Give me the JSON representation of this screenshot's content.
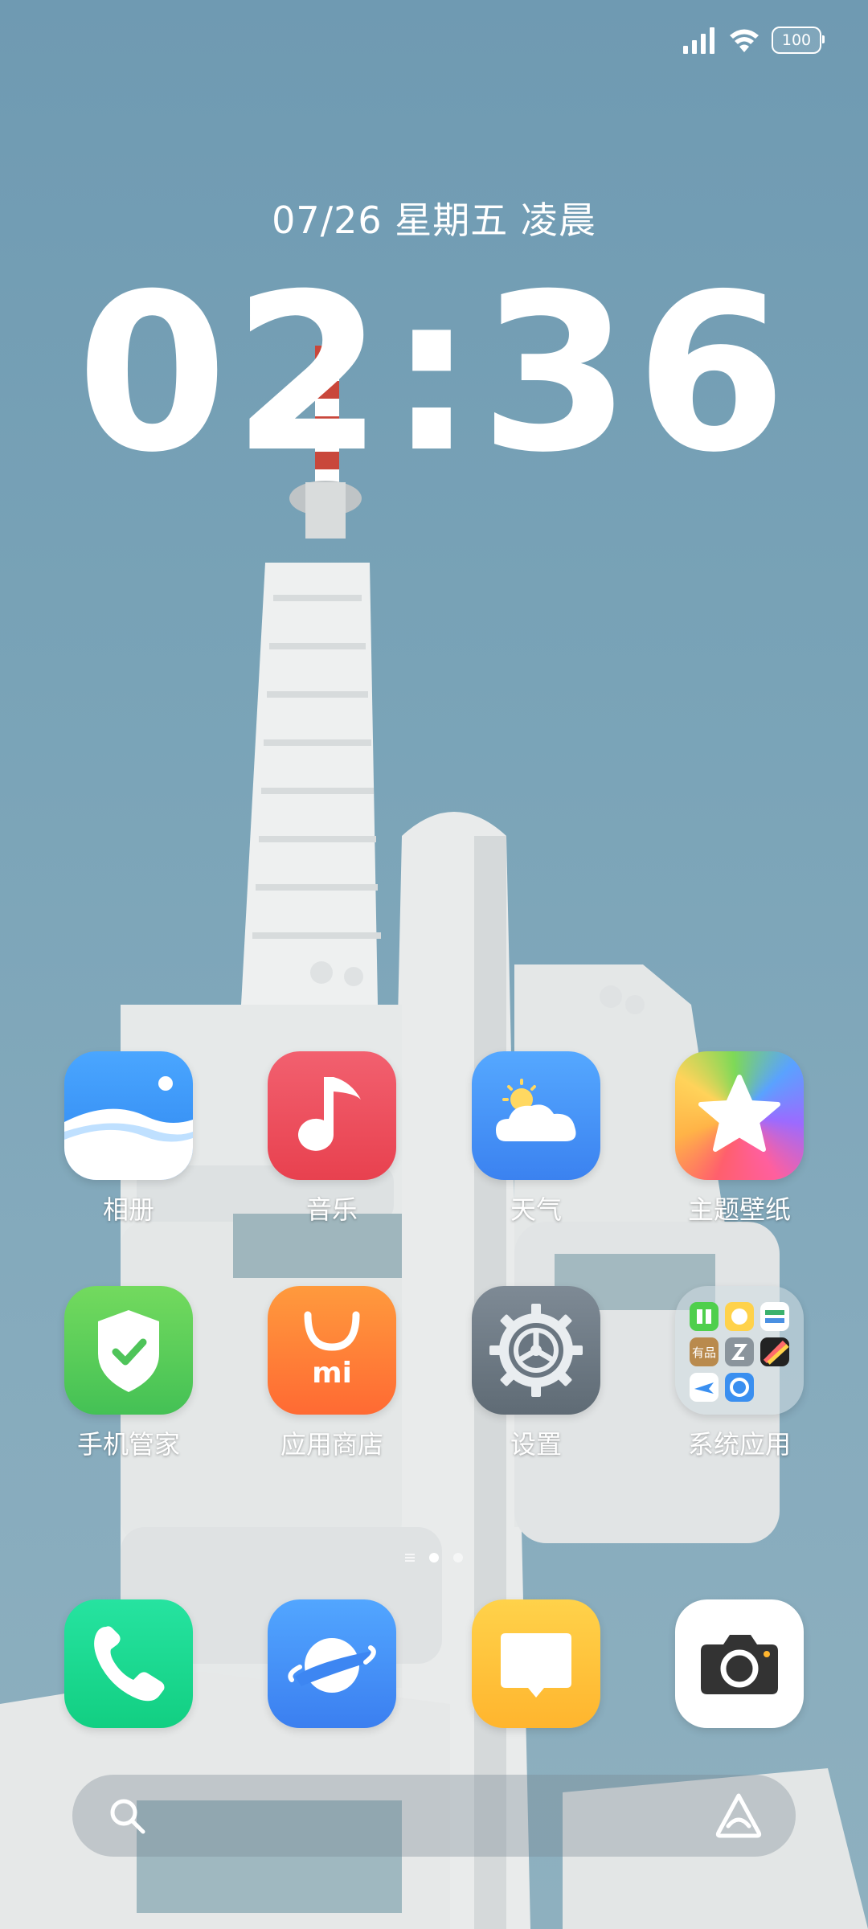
{
  "status_bar": {
    "signal_icon": "signal-icon",
    "wifi_icon": "wifi-icon",
    "battery_level": "100"
  },
  "lockclock": {
    "date": "07/26 星期五 凌晨",
    "time": "02:36"
  },
  "apps": [
    {
      "label": "相册",
      "icon": "gallery-icon"
    },
    {
      "label": "音乐",
      "icon": "music-icon"
    },
    {
      "label": "天气",
      "icon": "weather-icon"
    },
    {
      "label": "主题壁纸",
      "icon": "themes-icon"
    },
    {
      "label": "手机管家",
      "icon": "security-icon"
    },
    {
      "label": "应用商店",
      "icon": "app-store-icon"
    },
    {
      "label": "设置",
      "icon": "settings-icon"
    },
    {
      "label": "系统应用",
      "icon": "folder-icon",
      "folder_badge": "有品"
    }
  ],
  "pager": {
    "pages": 2,
    "active": 0
  },
  "dock": [
    {
      "icon": "phone-icon"
    },
    {
      "icon": "browser-icon"
    },
    {
      "icon": "messages-icon"
    },
    {
      "icon": "camera-icon"
    }
  ],
  "search_bar": {
    "icon": "search-icon",
    "assistant_icon": "assistant-icon"
  },
  "colors": {
    "sky": "#7aa3b8",
    "gallery_blue": "#3a8ff0",
    "music_red": "#ef5265",
    "weather_blue": "#4b95f3",
    "security_green": "#5fcf5a",
    "store_orange": "#ff7a3a",
    "settings_gray": "#6e7b86",
    "phone_green": "#19d68c",
    "browser_blue": "#3d8cf5",
    "messages_yellow": "#ffc33a"
  }
}
